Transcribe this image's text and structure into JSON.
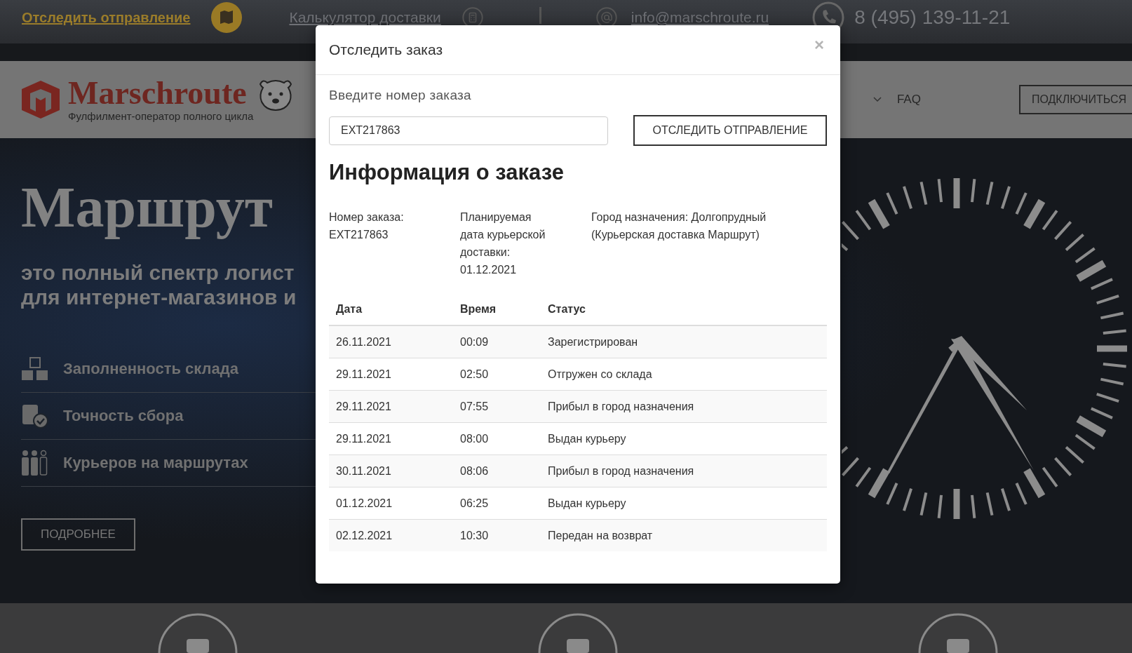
{
  "top_bar": {
    "track_link": "Отследить отправление",
    "calculator_link": "Калькулятор доставки",
    "email": "info@marschroute.ru",
    "phone": "8 (495) 139-11-21"
  },
  "header": {
    "logo_name": "Marschroute",
    "logo_tagline": "Фулфилмент-оператор полного цикла",
    "nav": [
      {
        "label": "FAQ"
      }
    ],
    "connect_button": "ПОДКЛЮЧИТЬСЯ"
  },
  "hero": {
    "title": "Маршрут",
    "subtitle_lines": [
      "это полный спектр логист",
      "для интернет-магазинов и"
    ],
    "stats": [
      {
        "kind": "warehouse",
        "label": "Заполненность склада"
      },
      {
        "kind": "accuracy",
        "label": "Точность сбора"
      },
      {
        "kind": "couriers",
        "label": "Курьеров на маршрутах"
      }
    ],
    "more_button": "ПОДРОБНЕЕ"
  },
  "modal": {
    "title": "Отследить заказ",
    "close": "×",
    "input_label": "Введите номер заказа",
    "input_value": "EXT217863",
    "track_button": "ОТСЛЕДИТЬ ОТПРАВЛЕНИЕ",
    "info_heading": "Информация о заказе",
    "info": [
      {
        "lines": [
          "Номер заказа:",
          "EXT217863"
        ]
      },
      {
        "lines": [
          "Планируемая",
          "дата курьерской",
          "доставки:",
          "01.12.2021"
        ]
      },
      {
        "lines": [
          "Город назначения: Долгопрудный",
          "(Курьерская доставка Маршрут)"
        ]
      }
    ],
    "table": {
      "columns": [
        "Дата",
        "Время",
        "Статус"
      ],
      "rows": [
        [
          "26.11.2021",
          "00:09",
          "Зарегистрирован"
        ],
        [
          "29.11.2021",
          "02:50",
          "Отгружен со склада"
        ],
        [
          "29.11.2021",
          "07:55",
          "Прибыл в город назначения"
        ],
        [
          "29.11.2021",
          "08:00",
          "Выдан курьеру"
        ],
        [
          "30.11.2021",
          "08:06",
          "Прибыл в город назначения"
        ],
        [
          "01.12.2021",
          "06:25",
          "Выдан курьеру"
        ],
        [
          "02.12.2021",
          "10:30",
          "Передан на возврат"
        ]
      ]
    }
  }
}
